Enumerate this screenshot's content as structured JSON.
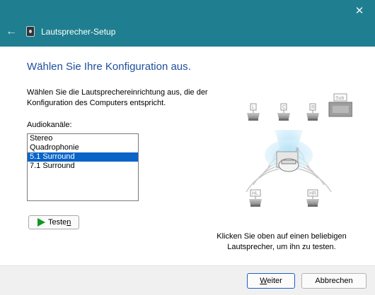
{
  "window": {
    "title": "Lautsprecher-Setup",
    "close_symbol": "✕",
    "back_symbol": "←",
    "icons": {
      "back": "arrow-left-icon",
      "app": "speaker-icon",
      "close": "close-icon"
    }
  },
  "main": {
    "heading": "Wählen Sie Ihre Konfiguration aus.",
    "description": "Wählen Sie die Lautsprechereinrichtung aus, die der Konfiguration des Computers entspricht.",
    "channels_label": "Audiokanäle:",
    "channels": [
      "Stereo",
      "Quadrophonie",
      "5.1 Surround",
      "7.1 Surround"
    ],
    "selected_channel": "5.1 Surround",
    "test_button": {
      "pre": "Teste",
      "mnemonic": "n",
      "post": "",
      "icon": "play-icon"
    },
    "diagram": {
      "speakers": {
        "left": "L",
        "center": "C",
        "right": "R",
        "subwoofer": "Sub",
        "rear_left": "HL",
        "rear_right": "HR"
      },
      "listener": "B"
    },
    "hint": "Klicken Sie oben auf einen beliebigen Lautsprecher, um ihn zu testen."
  },
  "footer": {
    "next": {
      "pre": "",
      "mnemonic": "W",
      "post": "eiter"
    },
    "cancel": "Abbrechen"
  },
  "colors": {
    "titlebar": "#1f7f90",
    "heading": "#1f4e9c",
    "selection": "#0a64c8",
    "play": "#129622",
    "primary_border": "#1f5fc4"
  }
}
